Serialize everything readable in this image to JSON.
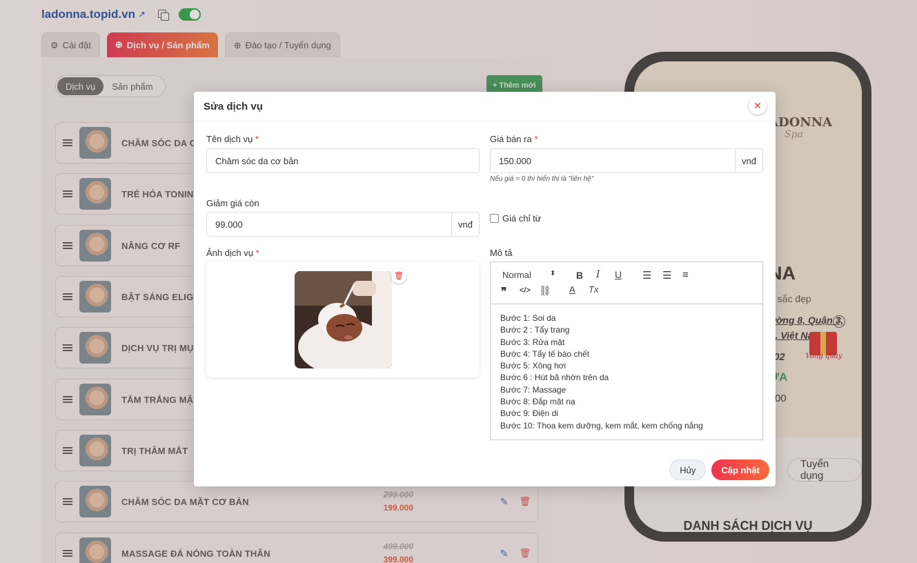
{
  "header": {
    "domain": "ladonna.topid.vn"
  },
  "tabs": [
    {
      "label": "Cài đặt",
      "icon": "gear-icon"
    },
    {
      "label": "Dịch vụ / Sản phẩm",
      "icon": "plus-circle-icon"
    },
    {
      "label": "Đào tạo / Tuyển dụng",
      "icon": "plus-circle-icon"
    }
  ],
  "segment": {
    "services": "Dịch vụ",
    "products": "Sản phẩm"
  },
  "add_button": "+ Thêm mới",
  "services": [
    {
      "name": "CHĂM SÓC DA CƠ BẢN"
    },
    {
      "name": "TRẺ HÓA TONING"
    },
    {
      "name": "NÂNG CƠ RF"
    },
    {
      "name": "BẬT SÁNG ELIGHT"
    },
    {
      "name": "DỊCH VỤ TRỊ MỤN"
    },
    {
      "name": "TẮM TRẮNG MẶT"
    },
    {
      "name": "TRỊ THÂM MẮT"
    },
    {
      "name": "CHĂM SÓC DA MẶT CƠ BẢN",
      "old_price": "299.000",
      "new_price": "199.000"
    },
    {
      "name": "MASSAGE ĐÁ NÓNG TOÀN THÂN",
      "old_price": "499.000",
      "new_price": "399.000"
    }
  ],
  "phone": {
    "logo": "ADONNA",
    "logo_sub": "Spa",
    "big": "NA",
    "sub": "a sắc đẹp",
    "addr1": "ường 8, Quận 3,",
    "addr2": "h, Việt Nam",
    "num": "02",
    "green": "ỬA",
    "num2": "00",
    "gift_label": "Vòng quay",
    "pill_right": "Tuyển dụng",
    "list_title": "DANH SÁCH DỊCH VỤ"
  },
  "modal": {
    "title": "Sửa dịch vụ",
    "name_label": "Tên dịch vụ",
    "name_value": "Chăm sóc da cơ bản",
    "price_label": "Giá bán ra",
    "price_value": "150.000",
    "unit": "vnđ",
    "price_hint": "Nếu giá = 0 thì hiển thị là \"liên hệ\"",
    "discount_label": "Giảm giá còn",
    "discount_value": "99.000",
    "from_price_label": "Giá chỉ từ",
    "image_label": "Ảnh dịch vụ",
    "desc_label": "Mô tả",
    "editor_format": "Normal",
    "desc_lines": [
      "Bước 1: Soi da",
      "Bước 2 : Tẩy trang",
      "Bước 3: Rửa mặt",
      "Bước 4: Tẩy tế bào chết",
      "Bước 5: Xông hơi",
      "Bước 6 : Hút bã nhờn trên da",
      "Bước 7: Massage",
      "Bước 8: Đắp mặt nạ",
      "Bước 9: Điện di",
      "Bước 10: Thoa kem dưỡng, kem mắt, kem chống nắng"
    ],
    "cancel": "Hủy",
    "save": "Cập nhật"
  },
  "colors": {
    "accent": "#f0334f",
    "accent2": "#f76a3a",
    "link": "#1f4fa3",
    "toggle_on": "#28a745"
  }
}
